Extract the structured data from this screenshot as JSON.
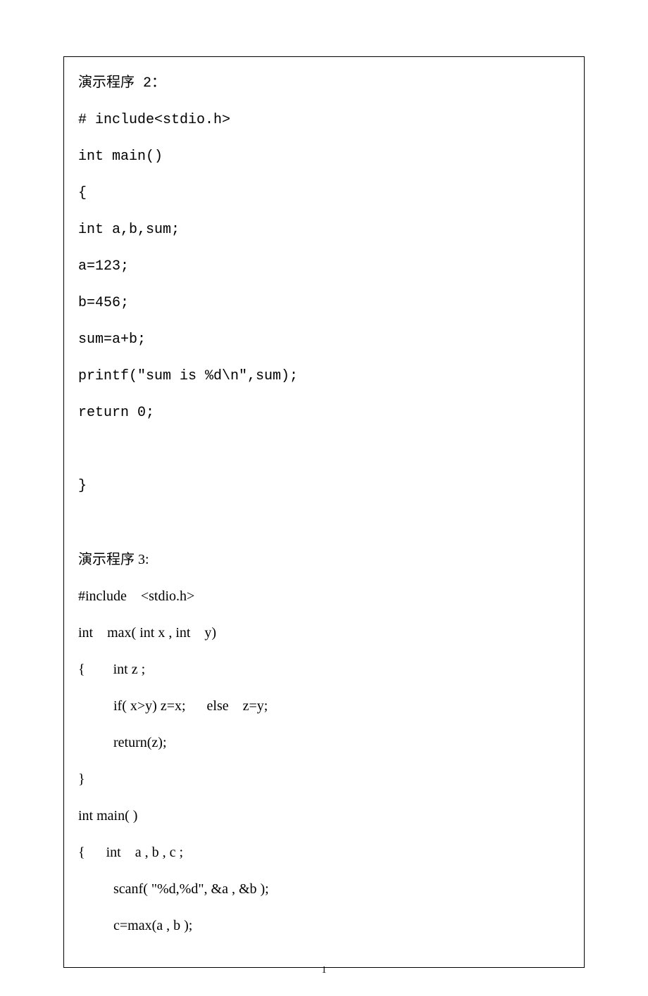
{
  "lines": [
    {
      "text": "演示程序 2：",
      "cls": "line mono"
    },
    {
      "text": "# include<stdio.h>",
      "cls": "line mono"
    },
    {
      "text": "int main()",
      "cls": "line mono"
    },
    {
      "text": "{",
      "cls": "line mono"
    },
    {
      "text": "int a,b,sum;",
      "cls": "line mono"
    },
    {
      "text": "a=123;",
      "cls": "line mono"
    },
    {
      "text": "b=456;",
      "cls": "line mono"
    },
    {
      "text": "sum=a+b;",
      "cls": "line mono"
    },
    {
      "text": "printf(\"sum is %d\\n\",sum);",
      "cls": "line mono"
    },
    {
      "text": "return 0;",
      "cls": "line mono"
    },
    {
      "text": " ",
      "cls": "line mono"
    },
    {
      "text": "}",
      "cls": "line mono"
    },
    {
      "text": " ",
      "cls": "line mono"
    },
    {
      "text": "演示程序 3:",
      "cls": "line serif"
    },
    {
      "text": "#include    <stdio.h>",
      "cls": "line serif"
    },
    {
      "text": "int    max( int x , int    y)",
      "cls": "line serif"
    },
    {
      "text": "{        int z ;",
      "cls": "line serif"
    },
    {
      "text": "          if( x>y) z=x;      else    z=y;",
      "cls": "line serif"
    },
    {
      "text": "          return(z);",
      "cls": "line serif"
    },
    {
      "text": "}",
      "cls": "line serif"
    },
    {
      "text": "int main( )",
      "cls": "line serif"
    },
    {
      "text": "{      int    a , b , c ;",
      "cls": "line serif"
    },
    {
      "text": "          scanf( \"%d,%d\", &a , &b );",
      "cls": "line serif"
    },
    {
      "text": "          c=max(a , b );",
      "cls": "line serif"
    }
  ],
  "page_number": "1"
}
